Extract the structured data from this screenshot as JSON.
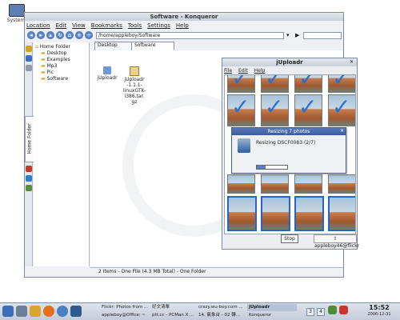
{
  "desktop": {
    "icon_label": "System"
  },
  "konqueror": {
    "title": "Software - Konqueror",
    "menu": [
      "Location",
      "Edit",
      "View",
      "Bookmarks",
      "Tools",
      "Settings",
      "Help"
    ],
    "url": "/home/appleboy/Software",
    "tabs": [
      "Desktop",
      "Software"
    ],
    "sidebar_tab_label": "Home Folder",
    "tree": [
      "Home Folder",
      "Desktop",
      "Examples",
      "Mp3",
      "Pic",
      "Software"
    ],
    "files": [
      {
        "name": "jUploadr",
        "icon": "folder-icon"
      },
      {
        "name": "jUploadr-1.1.1-linuxGTK-i386.tar.gz",
        "icon": "archive-icon"
      }
    ],
    "file2_lines": [
      "jUploadr",
      "-1.1.1-",
      "linuxGTK-",
      "i386.tar.",
      "gz"
    ],
    "status": "2 Items - One File (4.3 MB Total) - One Folder"
  },
  "juploadr": {
    "title": "jUploadr",
    "menu": [
      "File",
      "Edit",
      "Help"
    ],
    "stop_label": "Stop",
    "account_label": "appleboy46@flickr",
    "progress_dialog": {
      "title": "Resizing 7 photos",
      "text": "Resizing DSCF0083 (2/7)",
      "progress": 0.29
    }
  },
  "taskbar": {
    "tasks": [
      "Flickr: Photos from ...",
      "好文清單",
      "crazy.wu-boy.com ...",
      "jUploadr",
      "appleboy@Office: ~",
      "ptt.cc - PCMan X ...",
      "14. 氣象台 - 02 轉...",
      "Konqueror"
    ],
    "desktop_numbers": [
      "3",
      "4"
    ],
    "time": "15:52",
    "date": "2006-12-31"
  },
  "colors": {
    "accent": "#2a6fd3",
    "window_border": "#7a8aa0"
  }
}
